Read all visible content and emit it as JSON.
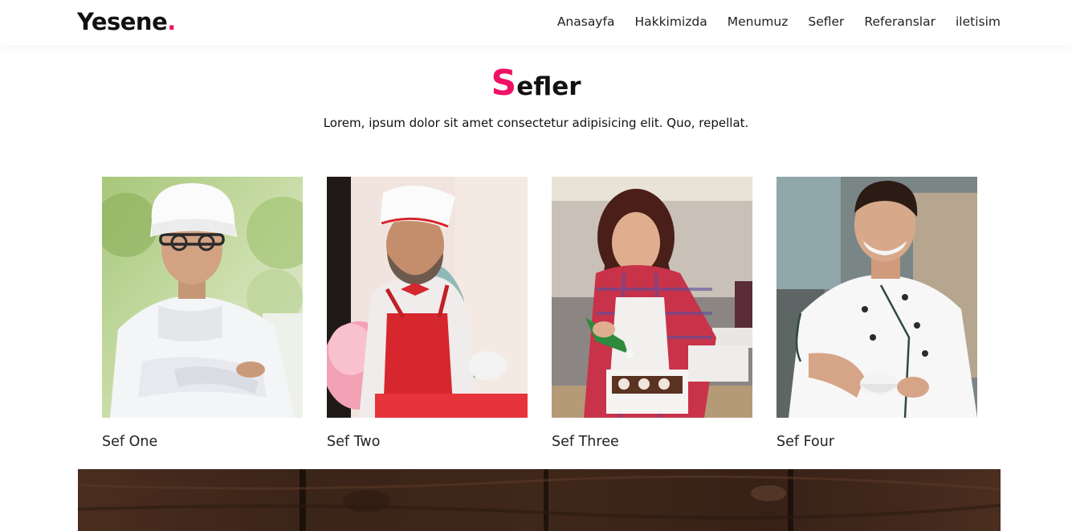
{
  "header": {
    "logo_text": "Yesene",
    "logo_dot": ".",
    "nav": [
      "Anasayfa",
      "Hakkimizda",
      "Menumuz",
      "Sefler",
      "Referanslar",
      "iletisim"
    ]
  },
  "section": {
    "title_first_letter": "S",
    "title_rest": "efler",
    "subtitle": "Lorem, ipsum dolor sit amet consectetur adipisicing elit. Quo, repellat."
  },
  "chefs": [
    {
      "name": "Sef One",
      "photo": "chef-with-glasses-and-toque-arms-crossed"
    },
    {
      "name": "Sef Two",
      "photo": "bearded-chef-red-apron-toque"
    },
    {
      "name": "Sef Three",
      "photo": "woman-chef-piping-bag-pastries"
    },
    {
      "name": "Sef Four",
      "photo": "smiling-chef-holding-cup"
    }
  ],
  "colors": {
    "accent": "#ee1166",
    "text": "#222222",
    "wood": "#3b2418"
  }
}
